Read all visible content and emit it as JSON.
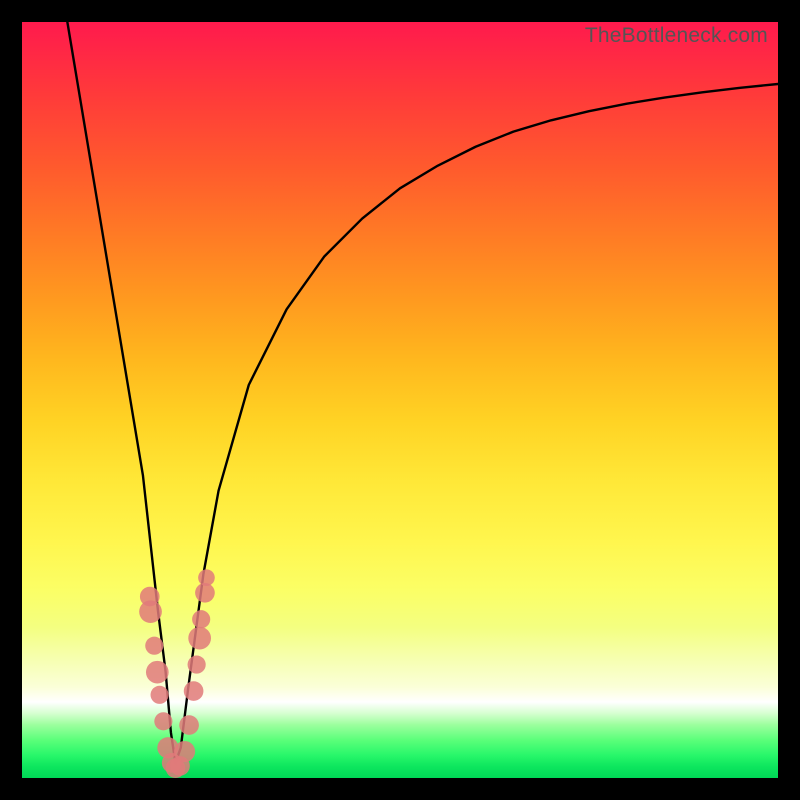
{
  "watermark": "TheBottleneck.com",
  "chart_data": {
    "type": "line",
    "title": "",
    "xlabel": "",
    "ylabel": "",
    "xlim": [
      0,
      100
    ],
    "ylim": [
      0,
      100
    ],
    "grid": false,
    "series": [
      {
        "name": "bottleneck-curve",
        "x": [
          6,
          8,
          10,
          12,
          14,
          16,
          17,
          18,
          19,
          19.7,
          20.3,
          21,
          22,
          24,
          26,
          30,
          35,
          40,
          45,
          50,
          55,
          60,
          65,
          70,
          75,
          80,
          85,
          90,
          95,
          100
        ],
        "values": [
          100,
          88,
          76,
          64,
          52,
          40,
          31,
          22,
          14,
          6,
          2,
          4,
          12,
          27,
          38,
          52,
          62,
          69,
          74,
          78,
          81,
          83.5,
          85.5,
          87,
          88.2,
          89.2,
          90,
          90.7,
          91.3,
          91.8
        ]
      }
    ],
    "markers": [
      {
        "x": 16.9,
        "y": 24.0,
        "r": 1.3
      },
      {
        "x": 17.0,
        "y": 22.0,
        "r": 1.5
      },
      {
        "x": 17.5,
        "y": 17.5,
        "r": 1.2
      },
      {
        "x": 17.9,
        "y": 14.0,
        "r": 1.5
      },
      {
        "x": 18.2,
        "y": 11.0,
        "r": 1.2
      },
      {
        "x": 18.7,
        "y": 7.5,
        "r": 1.2
      },
      {
        "x": 19.3,
        "y": 4.0,
        "r": 1.4
      },
      {
        "x": 19.8,
        "y": 2.0,
        "r": 1.3
      },
      {
        "x": 20.3,
        "y": 1.3,
        "r": 1.3
      },
      {
        "x": 20.9,
        "y": 1.6,
        "r": 1.3
      },
      {
        "x": 21.5,
        "y": 3.5,
        "r": 1.4
      },
      {
        "x": 22.1,
        "y": 7.0,
        "r": 1.3
      },
      {
        "x": 22.7,
        "y": 11.5,
        "r": 1.3
      },
      {
        "x": 23.1,
        "y": 15.0,
        "r": 1.2
      },
      {
        "x": 23.5,
        "y": 18.5,
        "r": 1.5
      },
      {
        "x": 23.7,
        "y": 21.0,
        "r": 1.2
      },
      {
        "x": 24.2,
        "y": 24.5,
        "r": 1.3
      },
      {
        "x": 24.4,
        "y": 26.5,
        "r": 1.1
      }
    ],
    "gradient_stops": [
      {
        "pos": 0,
        "color": "#ff1a4d"
      },
      {
        "pos": 20,
        "color": "#ff5a2d"
      },
      {
        "pos": 40,
        "color": "#ff9a1f"
      },
      {
        "pos": 60,
        "color": "#ffd324"
      },
      {
        "pos": 78,
        "color": "#fbff66"
      },
      {
        "pos": 88,
        "color": "#ffffff"
      },
      {
        "pos": 100,
        "color": "#00d857"
      }
    ],
    "minimum_at_x": 20.3,
    "green_band_y_fraction": 0.98
  }
}
